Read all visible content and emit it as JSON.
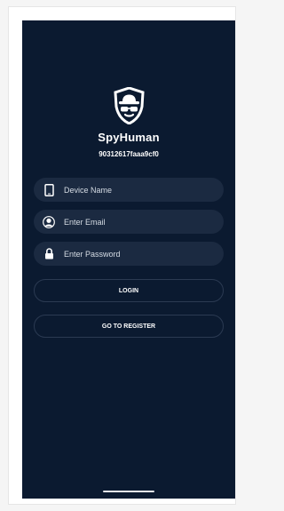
{
  "app": {
    "brand": "SpyHuman",
    "device_id": "90312617faaa9cf0",
    "logo_icon": "spy-hat-glasses-shield-logo"
  },
  "form": {
    "device_name_placeholder": "Device Name",
    "email_placeholder": "Enter Email",
    "password_placeholder": "Enter Password"
  },
  "actions": {
    "login_label": "LOGIN",
    "register_label": "GO TO REGISTER"
  },
  "colors": {
    "background": "#0b1a30",
    "field_background": "#1b2a41",
    "text": "#ffffff"
  }
}
